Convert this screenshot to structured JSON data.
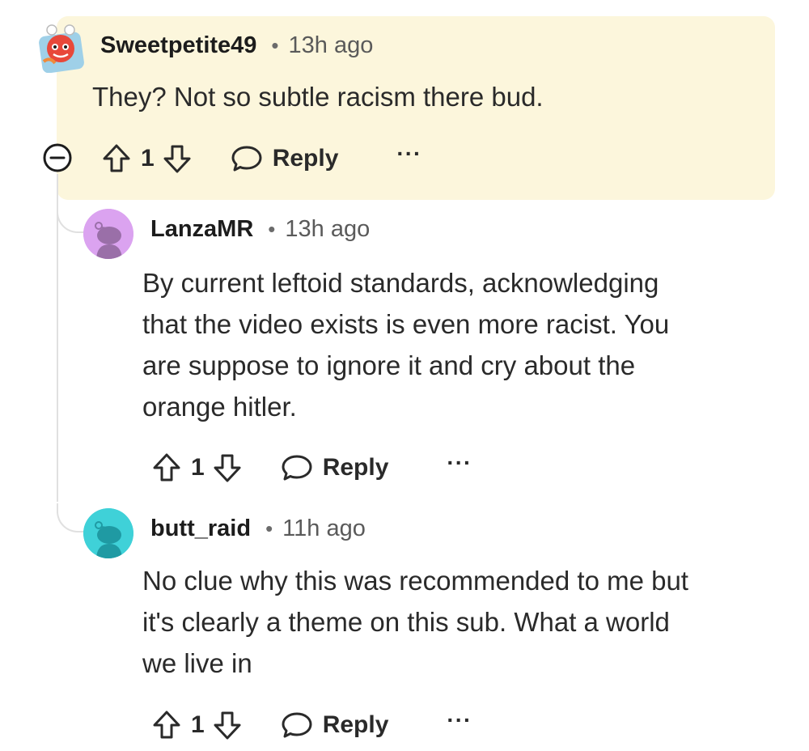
{
  "comments": [
    {
      "username": "Sweetpetite49",
      "separator": "•",
      "time": "13h ago",
      "body": [
        "They? Not so subtle racism there bud."
      ],
      "score": "1",
      "reply_label": "Reply",
      "more_label": "···",
      "avatar_color": "#e8483a",
      "highlighted": true
    },
    {
      "username": "LanzaMR",
      "separator": "•",
      "time": "13h ago",
      "body": [
        "By current leftoid standards, acknowledging",
        "that the video exists is even more racist. You",
        "are suppose to ignore it and cry about the",
        "orange hitler."
      ],
      "score": "1",
      "reply_label": "Reply",
      "more_label": "···",
      "avatar_color": "#dba3f0"
    },
    {
      "username": "butt_raid",
      "separator": "•",
      "time": "11h ago",
      "body": [
        "No clue why this was recommended to me but",
        "it's clearly a theme on this sub. What a world",
        "we live in"
      ],
      "score": "1",
      "reply_label": "Reply",
      "more_label": "···",
      "avatar_color": "#3fd1d8"
    }
  ],
  "colors": {
    "highlight_bg": "#fcf6dc",
    "thread_line": "#e0e0e0",
    "text": "#2a2a2a",
    "meta": "#5a5a5a"
  }
}
